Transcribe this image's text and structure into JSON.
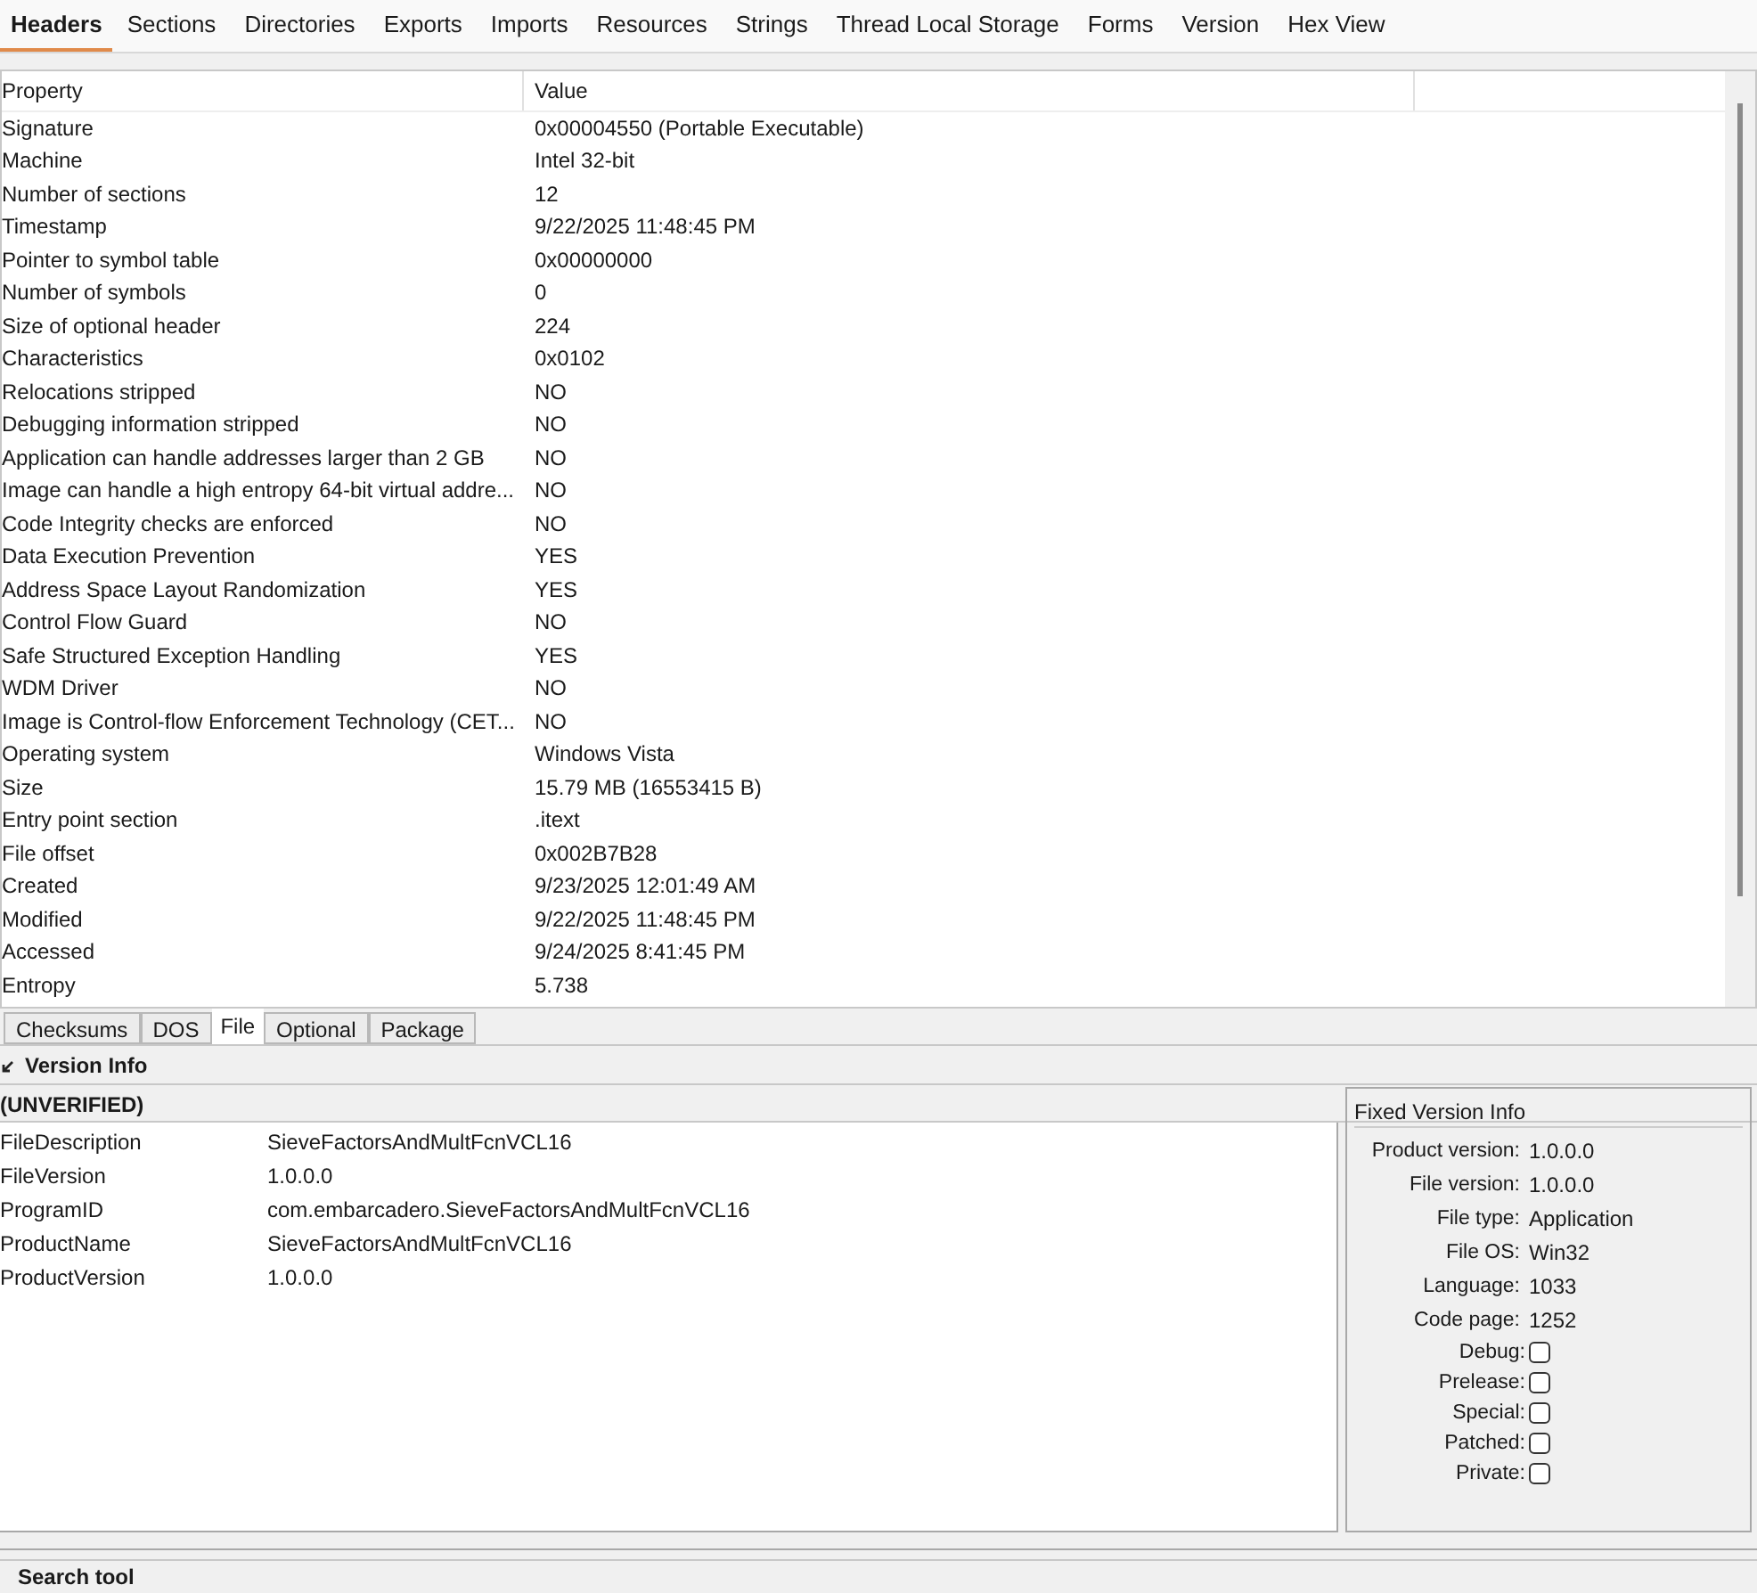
{
  "tabs": [
    {
      "label": "Headers",
      "selected": true
    },
    {
      "label": "Sections",
      "selected": false
    },
    {
      "label": "Directories",
      "selected": false
    },
    {
      "label": "Exports",
      "selected": false
    },
    {
      "label": "Imports",
      "selected": false
    },
    {
      "label": "Resources",
      "selected": false
    },
    {
      "label": "Strings",
      "selected": false
    },
    {
      "label": "Thread Local Storage",
      "selected": false
    },
    {
      "label": "Forms",
      "selected": false
    },
    {
      "label": "Version",
      "selected": false
    },
    {
      "label": "Hex View",
      "selected": false
    }
  ],
  "table": {
    "columns": [
      "Property",
      "Value"
    ],
    "rows": [
      [
        "Signature",
        "0x00004550 (Portable Executable)"
      ],
      [
        "Machine",
        "Intel 32-bit"
      ],
      [
        "Number of sections",
        "12"
      ],
      [
        "Timestamp",
        "9/22/2025 11:48:45 PM"
      ],
      [
        "Pointer to symbol table",
        "0x00000000"
      ],
      [
        "Number of symbols",
        "0"
      ],
      [
        "Size of optional header",
        "224"
      ],
      [
        "Characteristics",
        "0x0102"
      ],
      [
        "Relocations stripped",
        "NO"
      ],
      [
        "Debugging information stripped",
        "NO"
      ],
      [
        "Application can handle addresses larger than 2 GB",
        "NO"
      ],
      [
        "Image can handle a high entropy 64-bit virtual addre...",
        "NO"
      ],
      [
        "Code Integrity checks are enforced",
        "NO"
      ],
      [
        "Data Execution Prevention",
        "YES"
      ],
      [
        "Address Space Layout Randomization",
        "YES"
      ],
      [
        "Control Flow Guard",
        "NO"
      ],
      [
        "Safe Structured Exception Handling",
        "YES"
      ],
      [
        "WDM Driver",
        "NO"
      ],
      [
        "Image is Control-flow Enforcement Technology (CET...",
        "NO"
      ],
      [
        "Operating system",
        "Windows Vista"
      ],
      [
        "Size",
        "15.79 MB (16553415 B)"
      ],
      [
        "Entry point section",
        ".itext"
      ],
      [
        "File offset",
        "0x002B7B28"
      ],
      [
        "Created",
        "9/23/2025 12:01:49 AM"
      ],
      [
        "Modified",
        "9/22/2025 11:48:45 PM"
      ],
      [
        "Accessed",
        "9/24/2025 8:41:45 PM"
      ],
      [
        "Entropy",
        "5.738"
      ]
    ]
  },
  "sub_tabs": [
    {
      "label": "Checksums",
      "selected": false
    },
    {
      "label": "DOS",
      "selected": false
    },
    {
      "label": "File",
      "selected": true
    },
    {
      "label": "Optional",
      "selected": false
    },
    {
      "label": "Package",
      "selected": false
    }
  ],
  "version_info": {
    "title": "Version Info",
    "expanded": true,
    "heading": "(UNVERIFIED)",
    "rows": [
      [
        "FileDescription",
        "SieveFactorsAndMultFcnVCL16"
      ],
      [
        "FileVersion",
        "1.0.0.0"
      ],
      [
        "ProgramID",
        "com.embarcadero.SieveFactorsAndMultFcnVCL16"
      ],
      [
        "ProductName",
        "SieveFactorsAndMultFcnVCL16"
      ],
      [
        "ProductVersion",
        "1.0.0.0"
      ]
    ]
  },
  "fixed_version_info": {
    "title": "Fixed Version Info",
    "fields": [
      {
        "label": "Product version:",
        "value": "1.0.0.0"
      },
      {
        "label": "File version:",
        "value": "1.0.0.0"
      },
      {
        "label": "File type:",
        "value": "Application"
      },
      {
        "label": "File OS:",
        "value": "Win32"
      },
      {
        "label": "Language:",
        "value": "1033"
      },
      {
        "label": "Code page:",
        "value": "1252"
      }
    ],
    "flags": [
      {
        "label": "Debug:",
        "checked": false
      },
      {
        "label": "Prelease:",
        "checked": false
      },
      {
        "label": "Special:",
        "checked": false
      },
      {
        "label": "Patched:",
        "checked": false
      },
      {
        "label": "Private:",
        "checked": false
      }
    ]
  },
  "search_tool": {
    "title": "Search tool"
  }
}
